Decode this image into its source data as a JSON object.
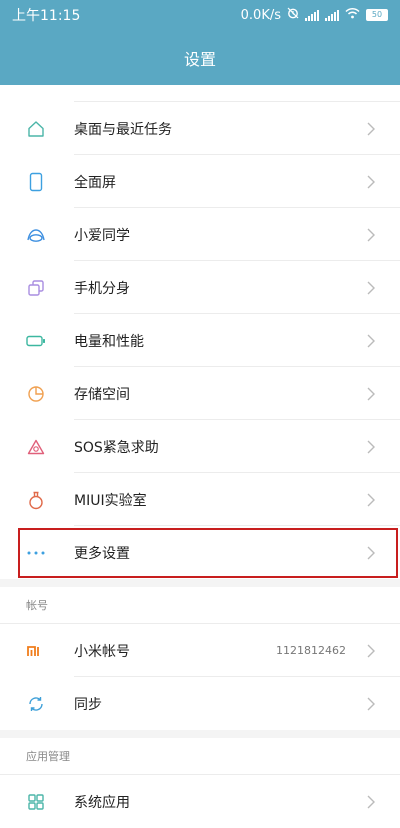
{
  "status": {
    "time": "上午11:15",
    "net_speed": "0.0K/s",
    "battery": "50"
  },
  "header": {
    "title": "设置"
  },
  "items": [
    {
      "label": "桌面与最近任务",
      "icon": "home-icon"
    },
    {
      "label": "全面屏",
      "icon": "phone-icon"
    },
    {
      "label": "小爱同学",
      "icon": "assistant-icon"
    },
    {
      "label": "手机分身",
      "icon": "clone-icon"
    },
    {
      "label": "电量和性能",
      "icon": "battery-icon"
    },
    {
      "label": "存储空间",
      "icon": "storage-icon"
    },
    {
      "label": "SOS紧急求助",
      "icon": "sos-icon"
    },
    {
      "label": "MIUI实验室",
      "icon": "lab-icon"
    },
    {
      "label": "更多设置",
      "icon": "more-icon"
    }
  ],
  "account_section": {
    "title": "帐号",
    "items": [
      {
        "label": "小米帐号",
        "value": "1121812462",
        "icon": "mi-logo-icon"
      },
      {
        "label": "同步",
        "icon": "sync-icon"
      }
    ]
  },
  "apps_section": {
    "title": "应用管理",
    "items": [
      {
        "label": "系统应用",
        "icon": "apps-icon"
      }
    ]
  },
  "colors": {
    "accent": "#5aa8c3",
    "highlight": "#c81e1e"
  }
}
